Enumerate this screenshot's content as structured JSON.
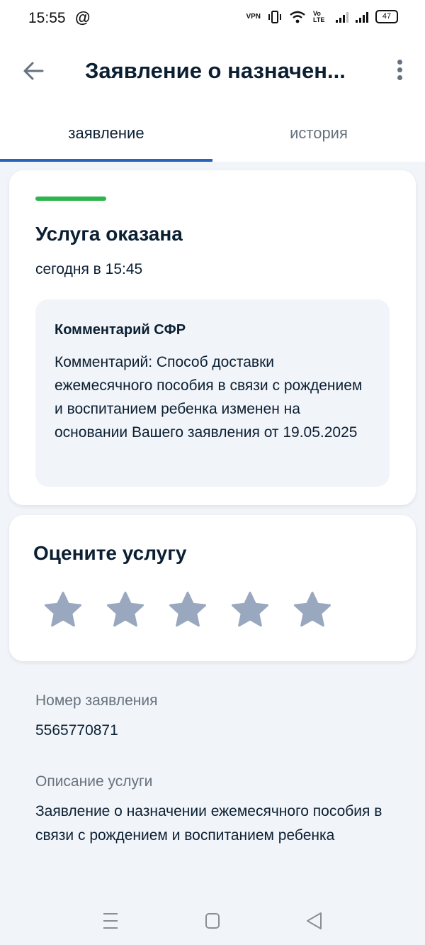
{
  "status_bar": {
    "time": "15:55",
    "at_symbol": "@",
    "vpn": "VPN",
    "volte": "Vo LTE",
    "battery": "47"
  },
  "header": {
    "title": "Заявление о назначен..."
  },
  "tabs": [
    {
      "label": "заявление",
      "active": true
    },
    {
      "label": "история",
      "active": false
    }
  ],
  "status_card": {
    "status": "Услуга оказана",
    "date": "сегодня в 15:45",
    "comment_title": "Комментарий СФР",
    "comment_text": "Комментарий: Способ доставки ежемесячного пособия в связи с рождением и воспитанием ребенка изменен на основании Вашего заявления от 19.05.2025"
  },
  "rating": {
    "title": "Оцените услугу",
    "stars_count": 5,
    "star_color": "#99a8bf"
  },
  "details": {
    "number_label": "Номер заявления",
    "number_value": "5565770871",
    "description_label": "Описание услуги",
    "description_value": "Заявление о назначении ежемесячного пособия в связи с рождением и воспитанием ребенка"
  },
  "colors": {
    "accent": "#2a63b8",
    "success": "#2db44a",
    "muted": "#66727f",
    "text": "#0b1f33"
  }
}
